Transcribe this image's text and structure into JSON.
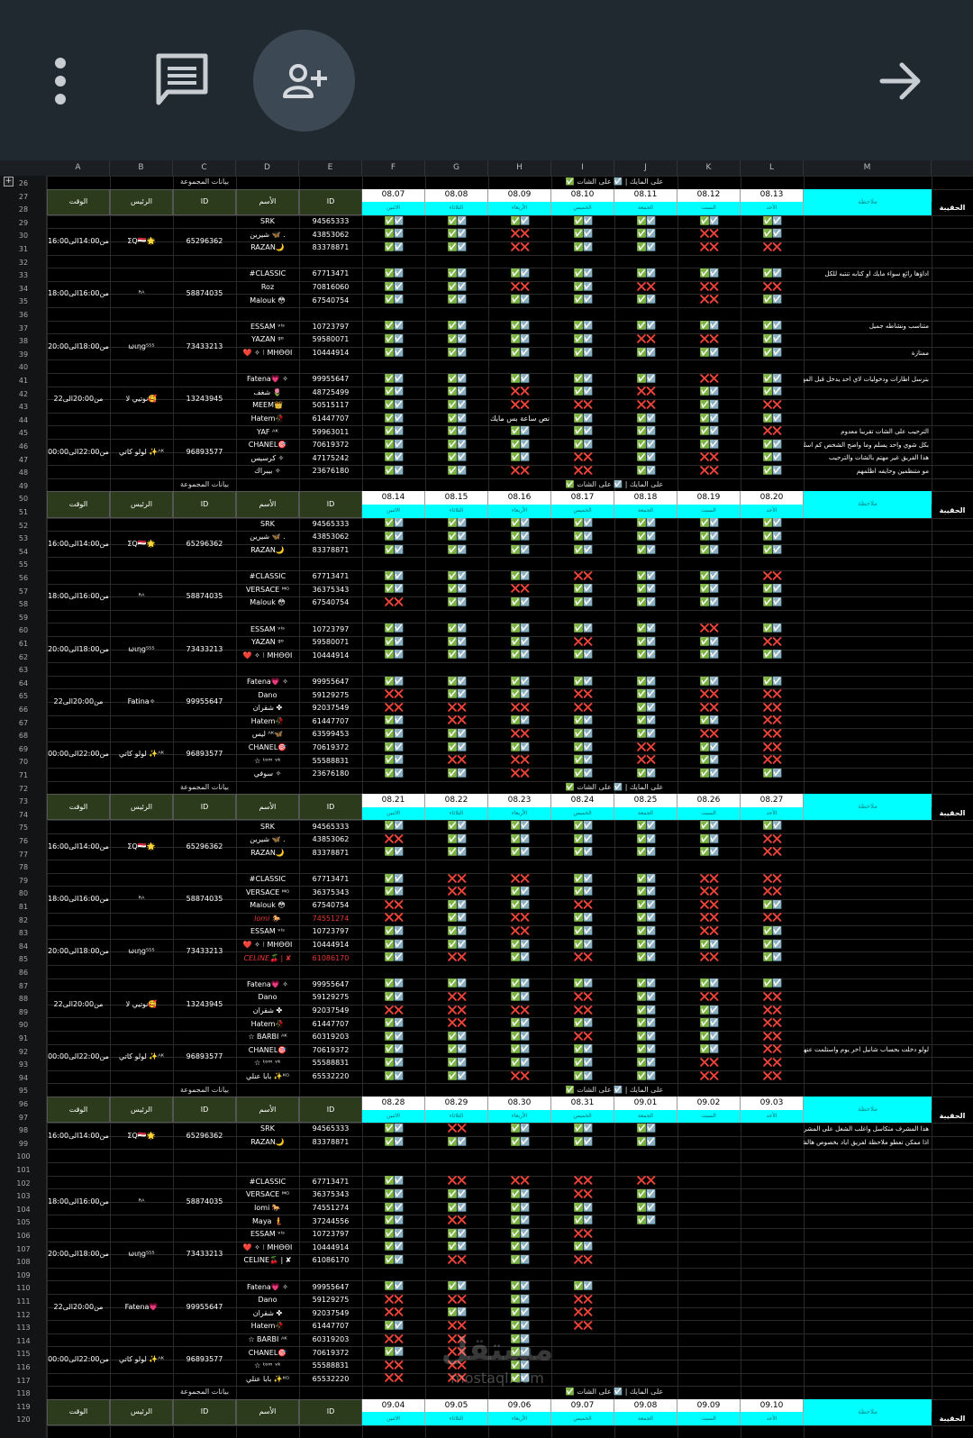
{
  "columns": [
    "A",
    "B",
    "C",
    "D",
    "E",
    "F",
    "G",
    "H",
    "I",
    "J",
    "K",
    "L",
    "M"
  ],
  "labels": {
    "group_data": "بيانات المجموعة",
    "legend": "✅ على المايك | ☑️ على الشات",
    "time": "الوقت",
    "leader": "الرئيس",
    "id": "ID",
    "name": "الأسم",
    "notes": "ملاحظة",
    "hq": "الحقيبة",
    "days": [
      "الاثنين",
      "الثلاثاء",
      "الأربعاء",
      "الخميس",
      "الجمعة",
      "السبت",
      "الأحد"
    ]
  },
  "icons": {
    "menu": "more-vert-icon",
    "chat": "chat-icon",
    "add_user": "person-add-icon",
    "forward": "arrow-forward-icon"
  },
  "colors": {
    "date_bg": "#ffffff",
    "day_bg": "#00ffff",
    "header_bg": "#2b3b1c",
    "ok": "#34c759",
    "no": "#e53935"
  },
  "watermark": {
    "main": "مستقل",
    "sub": "mostaql.com"
  },
  "weeks": [
    {
      "banner_row": 26,
      "header_rows": [
        27,
        28
      ],
      "dates": [
        "08.07",
        "08.08",
        "08.09",
        "08.10",
        "08.11",
        "08.12",
        "08.13"
      ],
      "shifts": [
        {
          "time": "من14:00الى16:00",
          "leader": "ΣQ🇪🇬🌟",
          "leader_id": "65296362",
          "members": [
            {
              "row": 29,
              "name": "SRK",
              "id": "94565333",
              "marks": "YYYYYYY",
              "note": ""
            },
            {
              "row": 30,
              "name": "شيرين 🦋 .",
              "id": "43853062",
              "marks": "YYNYYNY",
              "note": ""
            },
            {
              "row": 31,
              "name": "RAZAN🌙",
              "id": "83378871",
              "marks": "YYNYYNN",
              "note": ""
            }
          ],
          "blank": 32
        },
        {
          "time": "من16:00الى18:00",
          "leader": "ᴿᴬ",
          "leader_id": "58874035",
          "members": [
            {
              "row": 33,
              "name": "#CLASSIC",
              "id": "67713471",
              "marks": "YYYYYYY",
              "note": "اداؤها رائع سواء مايك او كتابه تنتبه للكل"
            },
            {
              "row": 34,
              "name": "Roz",
              "id": "70816060",
              "marks": "YYNYNNN",
              "note": ""
            },
            {
              "row": 35,
              "name": "Malouk 😳",
              "id": "67540754",
              "marks": "YYYYYNY",
              "note": ""
            }
          ],
          "blank": 36
        },
        {
          "time": "من18:00الى20:00",
          "leader": "ωιηg⁵⁵⁵",
          "leader_id": "73433213",
          "members": [
            {
              "row": 37,
              "name": "ESSAM ᵛⁱˢ",
              "id": "10723797",
              "marks": "YYYYYYY",
              "note": "متناسب ونشاطه جميل"
            },
            {
              "row": 38,
              "name": "YAZAN ᵍᵒ",
              "id": "59580071",
              "marks": "YYYYNNY",
              "note": ""
            },
            {
              "row": 39,
              "name": "❤️ ✧ ⁝ ΜΗΘΘΙ",
              "id": "10444914",
              "marks": "YYYYYYY",
              "note": "ممتازة"
            }
          ],
          "blank": 40
        },
        {
          "time": "من20:00الى22",
          "leader": "نوتيي لا🥰",
          "leader_id": "13243945",
          "members": [
            {
              "row": 41,
              "name": "Fatena💗 ✧",
              "id": "99955647",
              "marks": "YYYYYNY",
              "note": "بترسل اطارات ودخوليات لاي احد يدخل قبل المهمه"
            },
            {
              "row": 42,
              "name": "شغف 🌷",
              "id": "48725499",
              "marks": "YYNYNYY",
              "note": ""
            },
            {
              "row": 43,
              "name": "MEEM👑",
              "id": "50515117",
              "marks": "YYNNNYN",
              "note": ""
            },
            {
              "row": 44,
              "name": "Hatem🥀",
              "id": "61447707",
              "marks": "YY",
              "text_h": "نص ساعة بس مايك",
              "marks2": "YYYY",
              "note": ""
            }
          ],
          "blank": null
        },
        {
          "time": "من22:00الى00:00",
          "leader": "لولو كاتي ✨ᴬᴷ",
          "leader_id": "96893577",
          "members": [
            {
              "row": 45,
              "name": "YAF ᴬᴷ",
              "id": "59963011",
              "marks": "YYYYYYN",
              "note": "الترحيب على الشات تقريبا معدوم"
            },
            {
              "row": 46,
              "name": "CHANEL🎯",
              "id": "70619372",
              "marks": "YYYYYYY",
              "note": "بكل شوي واحد يسلم وما واضح الشخص كم اسلم ما"
            },
            {
              "row": 47,
              "name": "كرسيس ✧",
              "id": "47175242",
              "marks": "YYYNYNY",
              "note": "هذا الفريق غير مهتم بالشات والترحيب"
            },
            {
              "row": 48,
              "name": "بيبراك ✧",
              "id": "23676180",
              "marks": "YYNNYNY",
              "note": "مو متنظمين وحايفه اظلمهم"
            }
          ],
          "blank": null
        }
      ]
    },
    {
      "banner_row": 49,
      "header_rows": [
        50,
        51
      ],
      "dates": [
        "08.14",
        "08.15",
        "08.16",
        "08.17",
        "08.18",
        "08.19",
        "08.20"
      ],
      "shifts": [
        {
          "time": "من14:00الى16:00",
          "leader": "ΣQ🇪🇬🌟",
          "leader_id": "65296362",
          "members": [
            {
              "row": 52,
              "name": "SRK",
              "id": "94565333",
              "marks": "YYYYYYY",
              "note": ""
            },
            {
              "row": 53,
              "name": "شيرين 🦋 .",
              "id": "43853062",
              "marks": "YYYYYYY",
              "note": ""
            },
            {
              "row": 54,
              "name": "RAZAN🌙",
              "id": "83378871",
              "marks": "YYYYYYY",
              "note": ""
            }
          ],
          "blank": 55
        },
        {
          "time": "من16:00الى18:00",
          "leader": "ᴿᴬ",
          "leader_id": "58874035",
          "members": [
            {
              "row": 56,
              "name": "#CLASSIC",
              "id": "67713471",
              "marks": "YYYNYYN",
              "note": ""
            },
            {
              "row": 57,
              "name": "VERSACE ᴹᴳ",
              "id": "36375343",
              "marks": "YYNYYYY",
              "note": ""
            },
            {
              "row": 58,
              "name": "Malouk 😳",
              "id": "67540754",
              "marks": "NYYYYYY",
              "note": ""
            }
          ],
          "blank": 59
        },
        {
          "time": "من18:00الى20:00",
          "leader": "ωιηg⁵⁵⁵",
          "leader_id": "73433213",
          "members": [
            {
              "row": 60,
              "name": "ESSAM ᵛⁱˢ",
              "id": "10723797",
              "marks": "YYYYYNY",
              "note": ""
            },
            {
              "row": 61,
              "name": "YAZAN ᵍᵒ",
              "id": "59580071",
              "marks": "YYYNYYN",
              "note": ""
            },
            {
              "row": 62,
              "name": "❤️ ✧ ⁝ ΜΗΘΘΙ",
              "id": "10444914",
              "marks": "YYYYYYY",
              "note": ""
            }
          ],
          "blank": 63
        },
        {
          "time": "من20:00الى22",
          "leader": "Fatina✧",
          "leader_id": "99955647",
          "members": [
            {
              "row": 64,
              "name": "Fatena💗 ✧",
              "id": "99955647",
              "marks": "YYYYYYY",
              "note": ""
            },
            {
              "row": 65,
              "name": "Dano",
              "id": "59129275",
              "marks": "NYYNYNN",
              "note": ""
            },
            {
              "row": 66,
              "name": "شقران ✤",
              "id": "92037549",
              "marks": "NNNNYNN",
              "note": ""
            },
            {
              "row": 67,
              "name": "Hatem🥀",
              "id": "61447707",
              "marks": "YNYYYYN",
              "note": ""
            }
          ],
          "blank": null
        },
        {
          "time": "من22:00الى00:00",
          "leader": "لولو كاتي ✨ᴬᴷ",
          "leader_id": "96893577",
          "members": [
            {
              "row": 68,
              "name": "ليس ᴬᴷ🦋",
              "id": "63599453",
              "marks": "YYNYYNN",
              "note": ""
            },
            {
              "row": 69,
              "name": "CHANEL🎯",
              "id": "70619372",
              "marks": "YYYYNYN",
              "note": ""
            },
            {
              "row": 70,
              "name": "☆ ᵗᵒᵐ ᵛᵏ",
              "id": "55588831",
              "marks": "YNNYNYN",
              "note": ""
            },
            {
              "row": 71,
              "name": "سوفي ✧",
              "id": "23676180",
              "marks": "YYNYYYY",
              "note": ""
            }
          ],
          "blank": null
        }
      ]
    },
    {
      "banner_row": 72,
      "header_rows": [
        73,
        74
      ],
      "dates": [
        "08.21",
        "08.22",
        "08.23",
        "08.24",
        "08.25",
        "08.26",
        "08.27"
      ],
      "shifts": [
        {
          "time": "من14:00الى16:00",
          "leader": "ΣQ🇪🇬🌟",
          "leader_id": "65296362",
          "members": [
            {
              "row": 75,
              "name": "SRK",
              "id": "94565333",
              "marks": "YYYYYYY",
              "note": ""
            },
            {
              "row": 76,
              "name": "شيرين 🦋 .",
              "id": "43853062",
              "marks": "NYYYYYN",
              "note": ""
            },
            {
              "row": 77,
              "name": "RAZAN🌙",
              "id": "83378871",
              "marks": "YYYYYYN",
              "note": ""
            }
          ],
          "blank": 78
        },
        {
          "time": "من16:00الى18:00",
          "leader": "ᴿᴬ",
          "leader_id": "58874035",
          "members": [
            {
              "row": 79,
              "name": "#CLASSIC",
              "id": "67713471",
              "marks": "YNNYYNN",
              "note": ""
            },
            {
              "row": 80,
              "name": "VERSACE ᴹᴳ",
              "id": "36375343",
              "marks": "YNYYYNN",
              "note": ""
            },
            {
              "row": 81,
              "name": "Malouk 😳",
              "id": "67540754",
              "marks": "NYYNYNY",
              "note": ""
            },
            {
              "row": 82,
              "name": "lomi 🐎",
              "id": "74551274",
              "marks": "NYNYYNN",
              "note": "",
              "strike": true
            }
          ],
          "blank": null
        },
        {
          "time": "من18:00الى20:00",
          "leader": "ωιηg⁵⁵⁵",
          "leader_id": "73433213",
          "members": [
            {
              "row": 83,
              "name": "ESSAM ᵛⁱˢ",
              "id": "10723797",
              "marks": "YYNYYNY",
              "note": ""
            },
            {
              "row": 84,
              "name": "❤️ ✧ ⁝ ΜΗΘΘΙ",
              "id": "10444914",
              "marks": "YYYYYYY",
              "note": ""
            },
            {
              "row": 85,
              "name": "CELINE🍒 | ✘",
              "id": "61086170",
              "marks": "YNYNYNY",
              "note": "",
              "strike": true
            }
          ],
          "blank": 86
        },
        {
          "time": "من20:00الى22",
          "leader": "نوتيي لا🥰",
          "leader_id": "13243945",
          "members": [
            {
              "row": 87,
              "name": "Fatena💗 ✧",
              "id": "99955647",
              "marks": "YYYYYYY",
              "note": ""
            },
            {
              "row": 88,
              "name": "Dano",
              "id": "59129275",
              "marks": "YNYNYNN",
              "note": ""
            },
            {
              "row": 89,
              "name": "شقران ✤",
              "id": "92037549",
              "marks": "NNNNYYN",
              "note": ""
            },
            {
              "row": 90,
              "name": "Hatem🥀",
              "id": "61447707",
              "marks": "YNYYYYN",
              "note": ""
            }
          ],
          "blank": null
        },
        {
          "time": "من22:00الى00:00",
          "leader": "لولو كاتي ✨ᴬᴷ",
          "leader_id": "96893577",
          "members": [
            {
              "row": 91,
              "name": "☆ BARBI ᴬᴷ",
              "id": "60319203",
              "marks": "YYYNYYN",
              "note": ""
            },
            {
              "row": 92,
              "name": "CHANEL🎯",
              "id": "70619372",
              "marks": "YYYYYYN",
              "note": "لولو دخلت بحساب شانيل اخر يوم واستلمت عنها"
            },
            {
              "row": 93,
              "name": "☆ ᵗᵒᵐ ᵛᵏ",
              "id": "55588831",
              "marks": "YYYYYNN",
              "note": ""
            },
            {
              "row": 94,
              "name": "بابا عنلي ✨ᴷᴳ",
              "id": "65532220",
              "marks": "YYNYYNN",
              "note": ""
            }
          ],
          "blank": null
        }
      ]
    },
    {
      "banner_row": 95,
      "header_rows": [
        96,
        97
      ],
      "dates": [
        "08.28",
        "08.29",
        "08.30",
        "08.31",
        "09.01",
        "09.02",
        "09.03"
      ],
      "shifts": [
        {
          "time": "من14:00الى16:00",
          "leader": "ΣQ🇪🇬🌟",
          "leader_id": "65296362",
          "members": [
            {
              "row": 98,
              "name": "SRK",
              "id": "94565333",
              "marks": "YNYYY..",
              "note": "هذا المشرف متكاسل واغلب الشغل على المشرف الثاني"
            },
            {
              "row": 99,
              "name": "RAZAN🌙",
              "id": "83378871",
              "marks": "YYYYY..",
              "note": "اذا ممكن تعطو ملاحظة لفريق اياد بخصوص هالشي"
            }
          ],
          "blank": null
        },
        {
          "time": "من16:00الى18:00",
          "leader": "ᴿᴬ",
          "leader_id": "58874035",
          "members": [
            {
              "row": 102,
              "name": "#CLASSIC",
              "id": "67713471",
              "marks": "YNNNN..",
              "note": ""
            },
            {
              "row": 103,
              "name": "VERSACE ᴹᴳ",
              "id": "36375343",
              "marks": "YYYNY..",
              "note": ""
            },
            {
              "row": 104,
              "name": "lomi 🐎",
              "id": "74551274",
              "marks": "YYYYY..",
              "note": ""
            },
            {
              "row": 105,
              "name": "Maya 🧜",
              "id": "37244556",
              "marks": "YNYYY..",
              "note": ""
            }
          ],
          "blank": null
        },
        {
          "time": "من18:00الى20:00",
          "leader": "ωιηg⁵⁵⁵",
          "leader_id": "73433213",
          "members": [
            {
              "row": 106,
              "name": "ESSAM ᵛⁱˢ",
              "id": "10723797",
              "marks": "YYYN...",
              "note": ""
            },
            {
              "row": 107,
              "name": "❤️ ✧ ⁝ ΜΗΘΘΙ",
              "id": "10444914",
              "marks": "YYYY...",
              "note": ""
            },
            {
              "row": 108,
              "name": "CELINE🍒 | ✘",
              "id": "61086170",
              "marks": "YNYN...",
              "note": ""
            }
          ],
          "blank": 109
        },
        {
          "time": "من20:00الى22",
          "leader": "Fatena💗",
          "leader_id": "99955647",
          "members": [
            {
              "row": 110,
              "name": "Fatena💗 ✧",
              "id": "99955647",
              "marks": "YYYY...",
              "note": ""
            },
            {
              "row": 111,
              "name": "Dano",
              "id": "59129275",
              "marks": "NNYN...",
              "note": ""
            },
            {
              "row": 112,
              "name": "شقران ✤",
              "id": "92037549",
              "marks": "NYYN...",
              "note": ""
            },
            {
              "row": 113,
              "name": "Hatem🥀",
              "id": "61447707",
              "marks": "YNYN...",
              "note": ""
            }
          ],
          "blank": null
        },
        {
          "time": "من22:00الى00:00",
          "leader": "لولو كاتي ✨ᴬᴷ",
          "leader_id": "96893577",
          "members": [
            {
              "row": 114,
              "name": "☆ BARBI ᴬᴷ",
              "id": "60319203",
              "marks": "NNY....",
              "note": ""
            },
            {
              "row": 115,
              "name": "CHANEL🎯",
              "id": "70619372",
              "marks": "YNY....",
              "note": ""
            },
            {
              "row": 116,
              "name": "☆ ᵗᵒᵐ ᵛᵏ",
              "id": "55588831",
              "marks": "NNY....",
              "note": ""
            },
            {
              "row": 117,
              "name": "بابا عنلي ✨ᴷᴳ",
              "id": "65532220",
              "marks": "NNY....",
              "note": ""
            }
          ],
          "blank": null
        }
      ]
    },
    {
      "banner_row": 118,
      "header_rows": [
        119,
        120
      ],
      "dates": [
        "09.04",
        "09.05",
        "09.06",
        "09.07",
        "09.08",
        "09.09",
        "09.10"
      ],
      "shifts": []
    }
  ]
}
